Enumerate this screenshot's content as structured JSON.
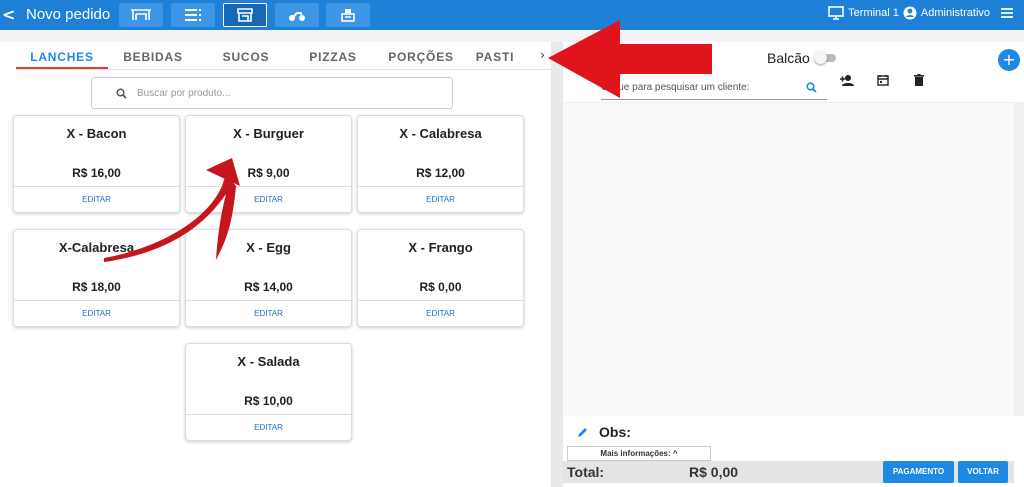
{
  "header": {
    "back_label": "<",
    "title": "Novo pedido",
    "terminal": "Terminal 1",
    "user": "Administrativo"
  },
  "tabs": [
    "LANCHES",
    "BEBIDAS",
    "SUCOS",
    "PIZZAS",
    "PORÇÕES",
    "PASTI"
  ],
  "tab_next": "›",
  "search": {
    "placeholder": "Buscar por produto..."
  },
  "products": [
    {
      "name": "X - Bacon",
      "price": "R$ 16,00",
      "edit": "EDITAR"
    },
    {
      "name": "X - Burguer",
      "price": "R$ 9,00",
      "edit": "EDITAR"
    },
    {
      "name": "X - Calabresa",
      "price": "R$ 12,00",
      "edit": "EDITAR"
    },
    {
      "name": "X-Calabresa",
      "price": "R$ 18,00",
      "edit": "EDITAR"
    },
    {
      "name": "X - Egg",
      "price": "R$ 14,00",
      "edit": "EDITAR"
    },
    {
      "name": "X - Frango",
      "price": "R$ 0,00",
      "edit": "EDITAR"
    },
    {
      "name": "X - Salada",
      "price": "R$ 10,00",
      "edit": "EDITAR"
    }
  ],
  "order": {
    "balcao_label": "Balcão",
    "add_label": "+",
    "client_placeholder": "Clique para pesquisar um cliente:",
    "obs_label": "Obs:",
    "mais_label": "Mais informações: ^",
    "total_label": "Total:",
    "total_value": "R$ 0,00",
    "pay_label": "PAGAMENTO",
    "back_label": "VOLTAR"
  },
  "colors": {
    "primary": "#1e88e5",
    "topbar": "#1f80d8",
    "annotation": "#e0151b"
  }
}
